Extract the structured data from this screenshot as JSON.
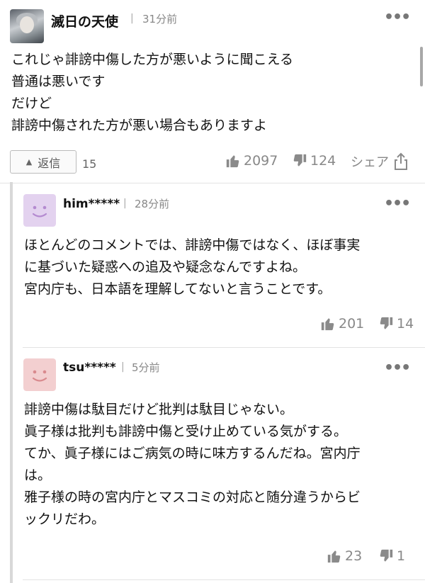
{
  "main_comment": {
    "username": "滅日の天使",
    "separator": "|",
    "time": "31分前",
    "more": "•••",
    "body": "これじゃ誹謗中傷した方が悪いように聞こえる\n普通は悪いです\nだけど\n誹謗中傷された方が悪い場合もありますよ",
    "reply_label": "返信",
    "reply_count": "15",
    "likes": "2097",
    "dislikes": "124",
    "share_label": "シェア"
  },
  "replies": [
    {
      "username": "him*****",
      "time": "28分前",
      "more": "•••",
      "avatar_color": "#e3d2ef",
      "face_color": "#b48ad0",
      "body": "ほとんどのコメントでは、誹謗中傷ではなく、ほぼ事実\nに基づいた疑惑への追及や疑念なんですよね。\n宮内庁も、日本語を理解してないと言うことです。",
      "likes": "201",
      "dislikes": "14"
    },
    {
      "username": "tsu*****",
      "time": "5分前",
      "more": "•••",
      "avatar_color": "#f3cfd0",
      "face_color": "#d98a8e",
      "body": "誹謗中傷は駄目だけど批判は駄目じゃない。\n眞子様は批判も誹謗中傷と受け止めている気がする。\nてか、眞子様にはご病気の時に味方するんだね。宮内庁\nは。\n雅子様の時の宮内庁とマスコミの対応と随分違うからビ\nックリだわ。",
      "likes": "23",
      "dislikes": "1"
    }
  ]
}
